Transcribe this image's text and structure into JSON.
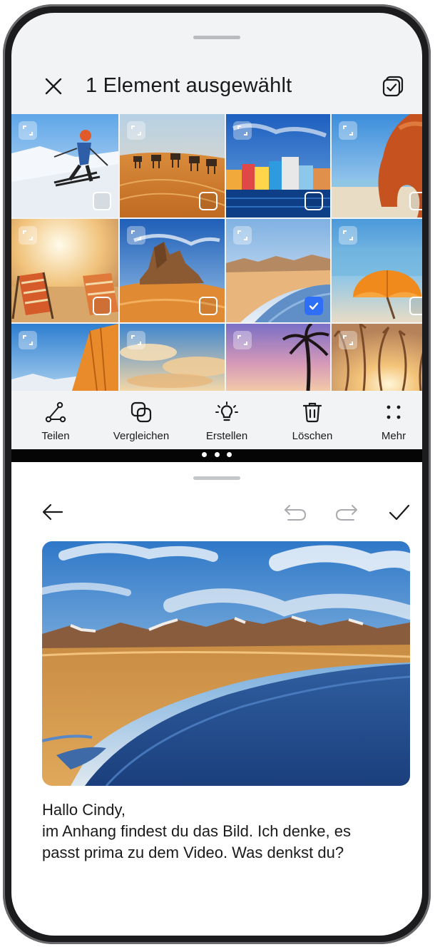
{
  "gallery": {
    "title": "1 Element ausgewählt",
    "selected_thumbnail": "Sandstrand mit Bergsee",
    "thumbnails": [
      {
        "subject": "Skifahrer",
        "selected": false
      },
      {
        "subject": "Kamelkarawane in der Wüste",
        "selected": false
      },
      {
        "subject": "Bunte Häuser am Wasser",
        "selected": false
      },
      {
        "subject": "Felsbogen am Strand",
        "selected": false
      },
      {
        "subject": "Liegestühle bei Sonnenuntergang",
        "selected": false
      },
      {
        "subject": "Wüstenfelsen",
        "selected": false
      },
      {
        "subject": "Sandstrand mit Bergsee",
        "selected": true
      },
      {
        "subject": "Orangener Sonnenschirm am Strand",
        "selected": false
      },
      {
        "subject": "Zeltplane und Berge",
        "selected": false
      },
      {
        "subject": "Wolken über dem Meer",
        "selected": false
      },
      {
        "subject": "Palme in der Abenddämmerung",
        "selected": false
      },
      {
        "subject": "Gräser im Gegenlicht",
        "selected": false
      }
    ],
    "toolbar": [
      {
        "label": "Teilen",
        "icon": "share-icon"
      },
      {
        "label": "Vergleichen",
        "icon": "compare-icon"
      },
      {
        "label": "Erstellen",
        "icon": "bulb-icon"
      },
      {
        "label": "Löschen",
        "icon": "trash-icon"
      },
      {
        "label": "Mehr",
        "icon": "more-icon"
      }
    ]
  },
  "composer": {
    "icons": {
      "back": "arrow-left-icon",
      "undo": "undo-icon",
      "redo": "redo-icon",
      "confirm": "check-icon"
    },
    "attached_image": "Sandstrand mit Bergsee",
    "message_lines": [
      "Hallo Cindy,",
      "im Anhang findest du das Bild. Ich denke, es",
      "passt prima zu dem Video. Was denkst du?"
    ]
  },
  "colors": {
    "accent": "#2f6ef6",
    "background": "#f1f3f5",
    "text": "#1a1a1a"
  }
}
